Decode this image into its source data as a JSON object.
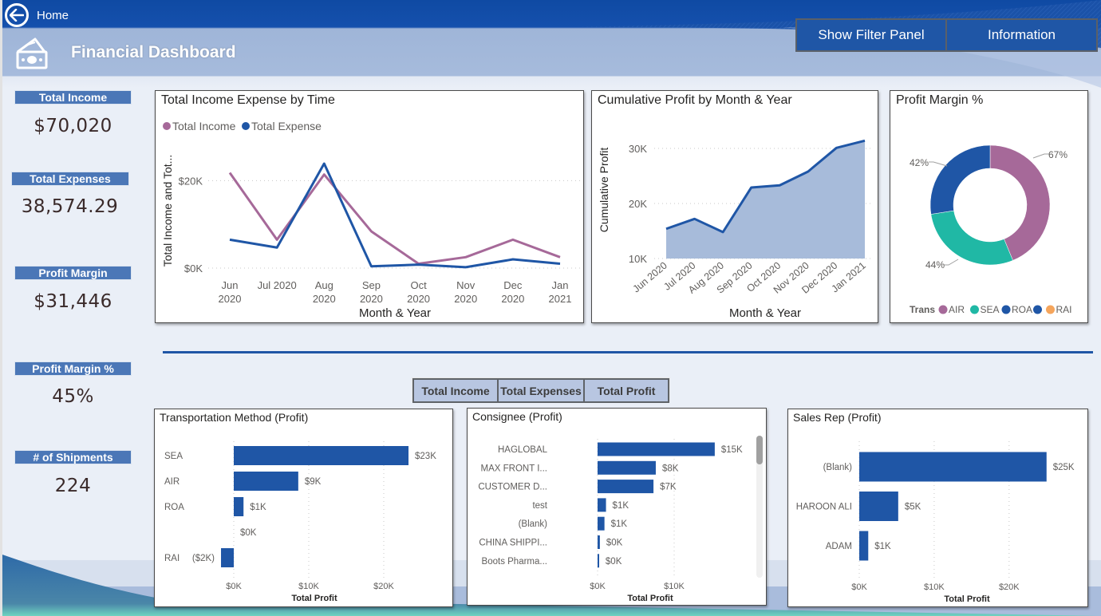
{
  "nav": {
    "home_label": "Home"
  },
  "header": {
    "title": "Financial Dashboard",
    "buttons": [
      {
        "label": "Show Filter Panel"
      },
      {
        "label": "Information"
      }
    ]
  },
  "kpis": [
    {
      "label": "Total Income",
      "value": "$70,020"
    },
    {
      "label": "Total Expenses",
      "value": "38,574.29"
    },
    {
      "label": "Profit Margin",
      "value": "$31,446"
    },
    {
      "label": "Profit Margin %",
      "value": "45%"
    },
    {
      "label": "# of Shipments",
      "value": "224"
    }
  ],
  "measure_toggle": {
    "options": [
      {
        "label": "Total Income"
      },
      {
        "label": "Total Expenses"
      },
      {
        "label": "Total Profit"
      }
    ]
  },
  "colors": {
    "brand_blue": "#1f56a6",
    "income_purple": "#a66999",
    "air_purple": "#a66999",
    "sea_teal": "#20b8a5",
    "roa_blue": "#1f56a6",
    "rai_orange": "#f5a55c"
  },
  "chart_data": [
    {
      "id": "income_expense",
      "type": "line",
      "title": "Total Income Expense by Time",
      "xlabel": "Month & Year",
      "ylabel": "Total Income and Tot...",
      "categories": [
        [
          "Jun",
          "2020"
        ],
        [
          "Jul 2020",
          ""
        ],
        [
          "Aug",
          "2020"
        ],
        [
          "Sep",
          "2020"
        ],
        [
          "Oct",
          "2020"
        ],
        [
          "Nov",
          "2020"
        ],
        [
          "Dec",
          "2020"
        ],
        [
          "Jan",
          "2021"
        ]
      ],
      "yticks": [
        {
          "value": 0,
          "label": "$0K"
        },
        {
          "value": 20000,
          "label": "$20K"
        }
      ],
      "ylim": [
        0,
        25000
      ],
      "legend": "top-left",
      "grid": true,
      "series": [
        {
          "name": "Total Income",
          "color": "#a66999",
          "values": [
            21800,
            6500,
            21400,
            8400,
            1000,
            2500,
            6500,
            2500
          ]
        },
        {
          "name": "Total Expense",
          "color": "#1f56a6",
          "values": [
            6500,
            4700,
            23900,
            400,
            800,
            200,
            2000,
            1000
          ]
        }
      ]
    },
    {
      "id": "cumulative_profit",
      "type": "area",
      "title": "Cumulative Profit by Month & Year",
      "xlabel": "Month & Year",
      "ylabel": "Cumulative Profit",
      "categories": [
        "Jun 2020",
        "Jul 2020",
        "Aug 2020",
        "Sep 2020",
        "Oct 2020",
        "Nov 2020",
        "Dec 2020",
        "Jan 2021"
      ],
      "yticks": [
        {
          "value": 10000,
          "label": "10K"
        },
        {
          "value": 20000,
          "label": "20K"
        },
        {
          "value": 30000,
          "label": "30K"
        }
      ],
      "ylim": [
        10000,
        32000
      ],
      "grid": true,
      "series": [
        {
          "name": "Cumulative Profit",
          "color": "#1f56a6",
          "values": [
            15400,
            17200,
            14800,
            22900,
            23300,
            25800,
            30100,
            31400
          ]
        }
      ]
    },
    {
      "id": "profit_margin_pct",
      "type": "pie",
      "title": "Profit Margin %",
      "legend_title": "Trans",
      "legend": "bottom",
      "slices": [
        {
          "name": "AIR",
          "value": 67,
          "label": "67%",
          "color": "#a66999"
        },
        {
          "name": "SEA",
          "value": 44,
          "label": "44%",
          "color": "#20b8a5"
        },
        {
          "name": "ROA",
          "value": 42,
          "label": "42%",
          "color": "#1f56a6"
        }
      ],
      "legend_items": [
        {
          "name": "AIR",
          "color": "#a66999"
        },
        {
          "name": "SEA",
          "color": "#20b8a5"
        },
        {
          "name": "ROA",
          "color": "#1f56a6"
        },
        {
          "name": "",
          "color": "#1f56a6"
        },
        {
          "name": "RAI",
          "color": "#f5a55c"
        }
      ]
    },
    {
      "id": "transportation_profit",
      "type": "bar",
      "orientation": "horizontal",
      "title": "Transportation Method (Profit)",
      "xlabel": "Total Profit",
      "categories": [
        "SEA",
        "AIR",
        "ROA",
        "",
        "RAI"
      ],
      "values": [
        23300,
        8600,
        1300,
        0,
        -1700
      ],
      "value_labels": [
        "$23K",
        "$9K",
        "$1K",
        "$0K",
        "($2K)"
      ],
      "xticks": [
        {
          "value": 0,
          "label": "$0K"
        },
        {
          "value": 10000,
          "label": "$10K"
        },
        {
          "value": 20000,
          "label": "$20K"
        }
      ],
      "xlim": [
        -3300,
        27000
      ]
    },
    {
      "id": "consignee_profit",
      "type": "bar",
      "orientation": "horizontal",
      "title": "Consignee (Profit)",
      "xlabel": "Total Profit",
      "categories": [
        "HAGLOBAL",
        "MAX FRONT I...",
        "CUSTOMER D...",
        "test",
        "(Blank)",
        "CHINA SHIPPI...",
        "Boots Pharma..."
      ],
      "values": [
        15300,
        7600,
        7300,
        1100,
        900,
        300,
        200
      ],
      "value_labels": [
        "$15K",
        "$8K",
        "$7K",
        "$1K",
        "$1K",
        "$0K",
        "$0K"
      ],
      "xticks": [
        {
          "value": 0,
          "label": "$0K"
        },
        {
          "value": 10000,
          "label": "$10K"
        }
      ],
      "xlim": [
        0,
        20000
      ]
    },
    {
      "id": "sales_rep_profit",
      "type": "bar",
      "orientation": "horizontal",
      "title": "Sales Rep (Profit)",
      "xlabel": "Total Profit",
      "categories": [
        "(Blank)",
        "HAROON ALI",
        "ADAM"
      ],
      "values": [
        25000,
        5200,
        1200
      ],
      "value_labels": [
        "$25K",
        "$5K",
        "$1K"
      ],
      "xticks": [
        {
          "value": 0,
          "label": "$0K"
        },
        {
          "value": 10000,
          "label": "$10K"
        },
        {
          "value": 20000,
          "label": "$20K"
        }
      ],
      "xlim": [
        0,
        29000
      ]
    }
  ]
}
